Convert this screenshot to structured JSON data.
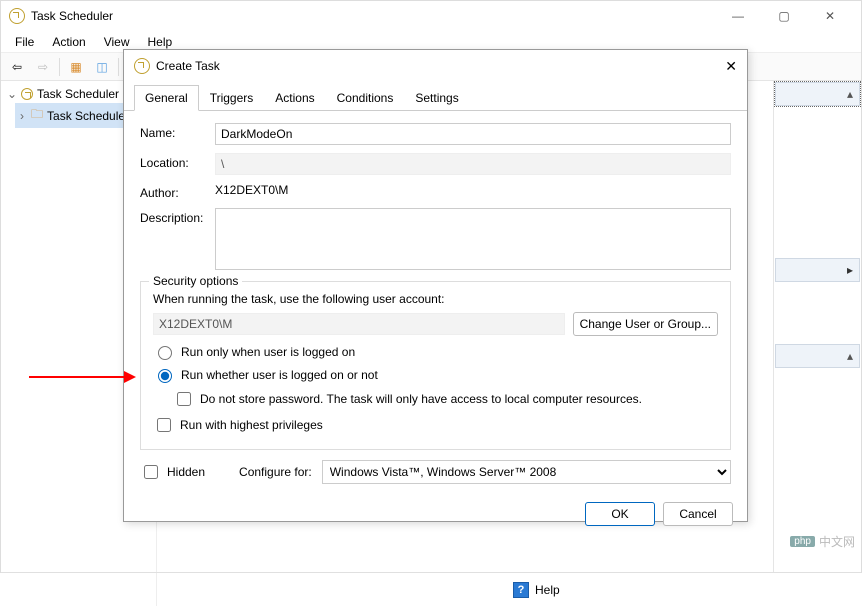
{
  "window": {
    "title": "Task Scheduler"
  },
  "menus": {
    "file": "File",
    "action": "Action",
    "view": "View",
    "help": "Help"
  },
  "tree": {
    "root": "Task Scheduler (L",
    "child": "Task Schedule"
  },
  "bottom": {
    "help": "Help"
  },
  "dialog": {
    "title": "Create Task",
    "tabs": {
      "general": "General",
      "triggers": "Triggers",
      "actions": "Actions",
      "conditions": "Conditions",
      "settings": "Settings"
    },
    "labels": {
      "name": "Name:",
      "location": "Location:",
      "author": "Author:",
      "description": "Description:"
    },
    "values": {
      "name": "DarkModeOn",
      "location": "\\",
      "author": "X12DEXT0\\M"
    },
    "security": {
      "legend": "Security options",
      "prompt": "When running the task, use the following user account:",
      "account": "X12DEXT0\\M",
      "change_btn": "Change User or Group...",
      "radio_logged_on": "Run only when user is logged on",
      "radio_whether": "Run whether user is logged on or not",
      "no_store_pw": "Do not store password.  The task will only have access to local computer resources.",
      "highest_priv": "Run with highest privileges"
    },
    "hidden_label": "Hidden",
    "config_label": "Configure for:",
    "config_value": "Windows Vista™, Windows Server™ 2008",
    "ok": "OK",
    "cancel": "Cancel"
  },
  "watermark": {
    "tag": "php",
    "text": "中文网"
  }
}
